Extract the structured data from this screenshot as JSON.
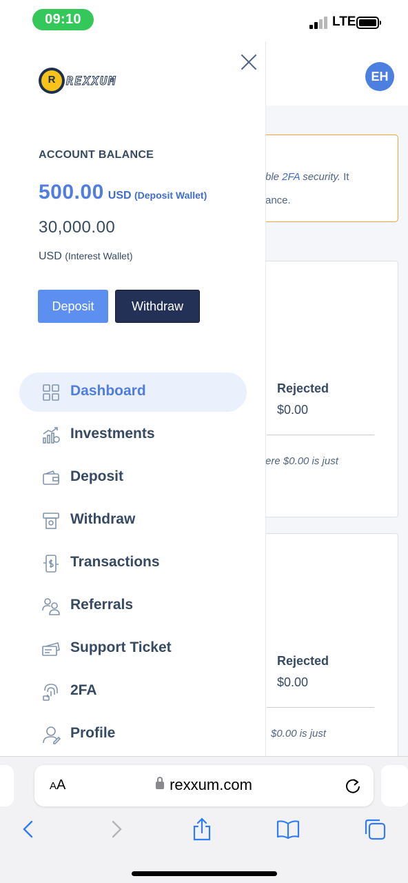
{
  "status_bar": {
    "time": "09:10",
    "network": "LTE"
  },
  "header": {
    "avatar_initials": "EH"
  },
  "drawer": {
    "logo_text": "REXXUM",
    "logo_letter": "R",
    "account_balance_title": "ACCOUNT BALANCE",
    "deposit_wallet_amount": "500.00",
    "deposit_wallet_currency": "USD",
    "deposit_wallet_label": "(Deposit Wallet)",
    "interest_wallet_amount": "30,000.00",
    "interest_wallet_currency": "USD",
    "interest_wallet_label": "(Interest Wallet)",
    "deposit_button": "Deposit",
    "withdraw_button": "Withdraw",
    "menu": [
      {
        "label": "Dashboard",
        "icon": "dashboard-icon",
        "active": true
      },
      {
        "label": "Investments",
        "icon": "investments-icon"
      },
      {
        "label": "Deposit",
        "icon": "wallet-icon"
      },
      {
        "label": "Withdraw",
        "icon": "atm-icon"
      },
      {
        "label": "Transactions",
        "icon": "transactions-icon"
      },
      {
        "label": "Referrals",
        "icon": "referrals-icon"
      },
      {
        "label": "Support Ticket",
        "icon": "ticket-icon"
      },
      {
        "label": "2FA",
        "icon": "fingerprint-icon"
      },
      {
        "label": "Profile",
        "icon": "user-icon"
      }
    ]
  },
  "background": {
    "alert_prefix": "ble ",
    "alert_highlight": "2FA",
    "alert_suffix": " security.",
    "alert_suffix2": " It",
    "alert_line2": "ance.",
    "card1": {
      "label": "Rejected",
      "value": "$0.00",
      "note": "ere $0.00 is just"
    },
    "card2": {
      "label": "Rejected",
      "value": "$0.00",
      "note": "$0.00 is just"
    }
  },
  "browser": {
    "text_size_label": "AA",
    "url": "rexxum.com"
  },
  "colors": {
    "accent": "#4f7ee0",
    "dark_button": "#243156",
    "alert_border": "#f4a534"
  }
}
